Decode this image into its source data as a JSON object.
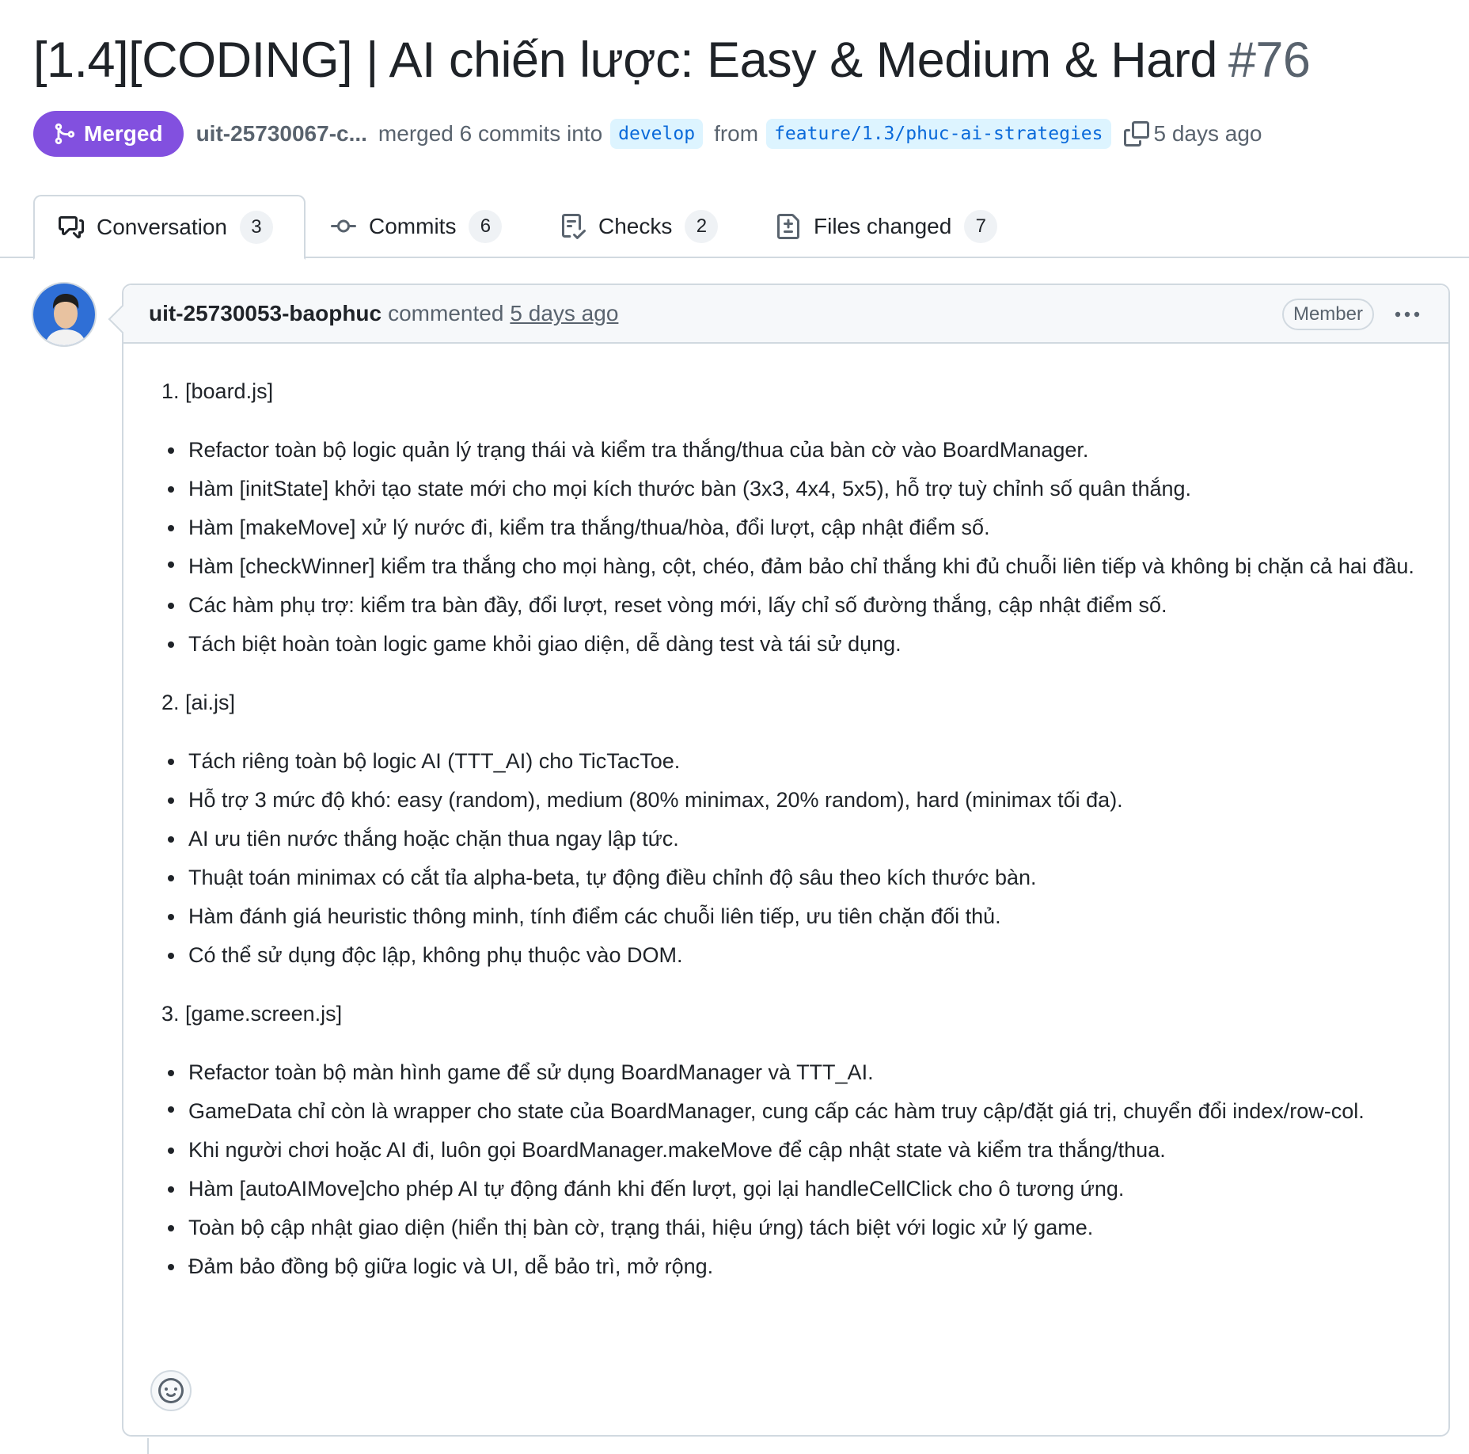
{
  "pr": {
    "title": "[1.4][CODING] | AI chiến lược: Easy & Medium & Hard",
    "number": "#76",
    "state_label": "Merged",
    "author": "uit-25730067-c...",
    "merge_text": "merged 6 commits into",
    "base_branch": "develop",
    "from_text": "from",
    "head_branch": "feature/1.3/phuc-ai-strategies",
    "time": "5 days ago"
  },
  "tabs": [
    {
      "label": "Conversation",
      "count": "3",
      "icon": "comment-discussion-icon"
    },
    {
      "label": "Commits",
      "count": "6",
      "icon": "git-commit-icon"
    },
    {
      "label": "Checks",
      "count": "2",
      "icon": "checklist-icon"
    },
    {
      "label": "Files changed",
      "count": "7",
      "icon": "file-diff-icon"
    }
  ],
  "comment": {
    "author": "uit-25730053-baophuc",
    "action": "commented",
    "time": "5 days ago",
    "role_badge": "Member",
    "sections": [
      {
        "title": "1. [board.js]",
        "items": [
          "Refactor toàn bộ logic quản lý trạng thái và kiểm tra thắng/thua của bàn cờ vào BoardManager.",
          "Hàm [initState] khởi tạo state mới cho mọi kích thước bàn (3x3, 4x4, 5x5), hỗ trợ tuỳ chỉnh số quân thắng.",
          "Hàm [makeMove] xử lý nước đi, kiểm tra thắng/thua/hòa, đổi lượt, cập nhật điểm số.",
          "Hàm [checkWinner] kiểm tra thắng cho mọi hàng, cột, chéo, đảm bảo chỉ thắng khi đủ chuỗi liên tiếp và không bị chặn cả hai đầu.",
          "Các hàm phụ trợ: kiểm tra bàn đầy, đổi lượt, reset vòng mới, lấy chỉ số đường thắng, cập nhật điểm số.",
          "Tách biệt hoàn toàn logic game khỏi giao diện, dễ dàng test và tái sử dụng."
        ]
      },
      {
        "title": "2. [ai.js]",
        "items": [
          "Tách riêng toàn bộ logic AI (TTT_AI) cho TicTacToe.",
          "Hỗ trợ 3 mức độ khó: easy (random), medium (80% minimax, 20% random), hard (minimax tối đa).",
          "AI ưu tiên nước thắng hoặc chặn thua ngay lập tức.",
          "Thuật toán minimax có cắt tỉa alpha-beta, tự động điều chỉnh độ sâu theo kích thước bàn.",
          "Hàm đánh giá heuristic thông minh, tính điểm các chuỗi liên tiếp, ưu tiên chặn đối thủ.",
          "Có thể sử dụng độc lập, không phụ thuộc vào DOM."
        ]
      },
      {
        "title": "3. [game.screen.js]",
        "items": [
          "Refactor toàn bộ màn hình game để sử dụng BoardManager và TTT_AI.",
          "GameData chỉ còn là wrapper cho state của BoardManager, cung cấp các hàm truy cập/đặt giá trị, chuyển đổi index/row-col.",
          "Khi người chơi hoặc AI đi, luôn gọi BoardManager.makeMove để cập nhật state và kiểm tra thắng/thua.",
          "Hàm [autoAIMove]cho phép AI tự động đánh khi đến lượt, gọi lại handleCellClick cho ô tương ứng.",
          "Toàn bộ cập nhật giao diện (hiển thị bàn cờ, trạng thái, hiệu ứng) tách biệt với logic xử lý game.",
          "Đảm bảo đồng bộ giữa logic và UI, dễ bảo trì, mở rộng."
        ]
      }
    ]
  },
  "colors": {
    "merged": "#8250df",
    "branch_text": "#0969da",
    "branch_bg": "#ddf4ff",
    "border": "#d1d9e0",
    "muted": "#59636e"
  }
}
